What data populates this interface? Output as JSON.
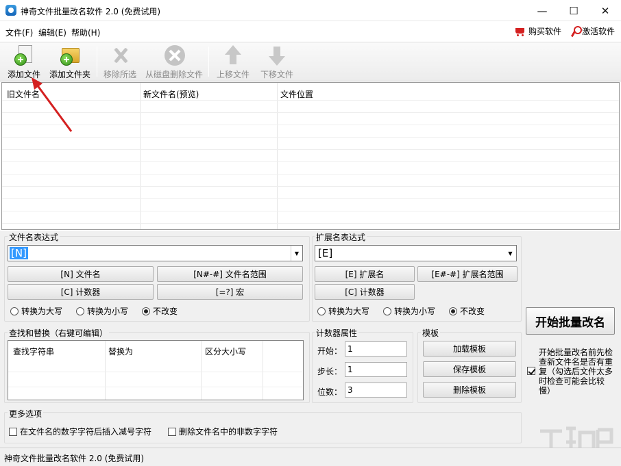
{
  "window": {
    "title": "神奇文件批量改名软件 2.0 (免费试用)",
    "minimize": "—",
    "maximize": "☐",
    "close": "✕"
  },
  "menu": {
    "items": [
      "文件(F)",
      "编辑(E)",
      "帮助(H)"
    ],
    "buy": "购买软件",
    "activate": "激活软件"
  },
  "toolbar": {
    "add_file": "添加文件",
    "add_folder": "添加文件夹",
    "remove_selected": "移除所选",
    "delete_from_disk": "从磁盘删除文件",
    "move_up": "上移文件",
    "move_down": "下移文件"
  },
  "file_list": {
    "columns": [
      "旧文件名",
      "新文件名(预览)",
      "文件位置"
    ]
  },
  "filename_expr": {
    "title": "文件名表达式",
    "value": "[N]",
    "btn_name": "[N] 文件名",
    "btn_range": "[N#-#] 文件名范围",
    "btn_counter": "[C] 计数器",
    "btn_macro": "[=?] 宏",
    "radio_upper": "转换为大写",
    "radio_lower": "转换为小写",
    "radio_keep": "不改变"
  },
  "ext_expr": {
    "title": "扩展名表达式",
    "value": "[E]",
    "btn_ext": "[E] 扩展名",
    "btn_range": "[E#-#] 扩展名范围",
    "btn_counter": "[C] 计数器",
    "radio_upper": "转换为大写",
    "radio_lower": "转换为小写",
    "radio_keep": "不改变"
  },
  "find_replace": {
    "title": "查找和替换（右键可编辑）",
    "columns": [
      "查找字符串",
      "替换为",
      "区分大小写"
    ]
  },
  "counter": {
    "title": "计数器属性",
    "start_label": "开始：",
    "start_value": "1",
    "step_label": "步长：",
    "step_value": "1",
    "digits_label": "位数：",
    "digits_value": "3"
  },
  "template": {
    "title": "模板",
    "load": "加载模板",
    "save": "保存模板",
    "delete": "删除模板"
  },
  "start": {
    "label": "开始批量改名",
    "check_text": "开始批量改名前先检查新文件名是否有重复（勾选后文件太多时检查可能会比较慢）"
  },
  "more_options": {
    "title": "更多选项",
    "opt1": "在文件名的数字字符后插入减号字符",
    "opt2": "删除文件名中的非数字字符"
  },
  "status": {
    "text": "神奇文件批量改名软件 2.0 (免费试用)"
  },
  "colors": {
    "accent_red": "#d42020",
    "selection_blue": "#3399ff"
  }
}
